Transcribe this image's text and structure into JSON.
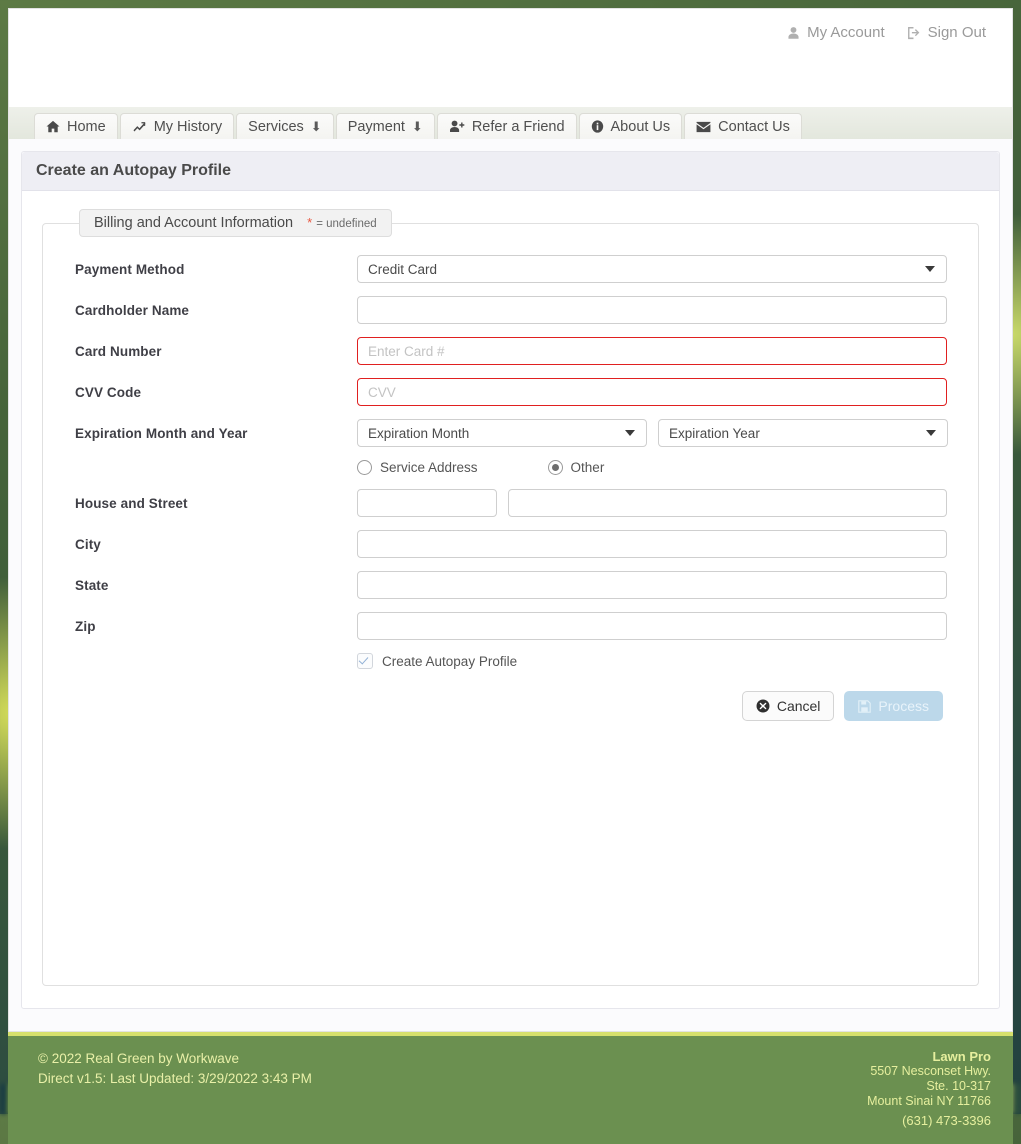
{
  "header": {
    "account_links": [
      {
        "label": "My Account",
        "icon": "user-icon"
      },
      {
        "label": "Sign Out",
        "icon": "sign-out-icon"
      }
    ]
  },
  "nav": {
    "tabs": [
      {
        "label": "Home",
        "icon": "home-icon",
        "caret": false
      },
      {
        "label": "My History",
        "icon": "chart-line-icon",
        "caret": false
      },
      {
        "label": "Services",
        "icon": "",
        "caret": true,
        "caret_glyph": "⬇"
      },
      {
        "label": "Payment",
        "icon": "",
        "caret": true,
        "caret_glyph": "⬇"
      },
      {
        "label": "Refer a Friend",
        "icon": "user-plus-icon",
        "caret": false
      },
      {
        "label": "About Us",
        "icon": "info-circle-icon",
        "caret": false
      },
      {
        "label": "Contact Us",
        "icon": "envelope-icon",
        "caret": false
      }
    ]
  },
  "panel": {
    "title": "Create an Autopay Profile",
    "legend": "Billing and Account Information",
    "legend_required_mark": "*",
    "legend_required_text": "= undefined"
  },
  "form": {
    "payment_method": {
      "label": "Payment Method",
      "value": "Credit Card",
      "options": [
        "Credit Card"
      ]
    },
    "cardholder_name": {
      "label": "Cardholder Name",
      "value": "",
      "placeholder": ""
    },
    "card_number": {
      "label": "Card Number",
      "value": "",
      "placeholder": "Enter Card #",
      "error": true
    },
    "cvv_code": {
      "label": "CVV Code",
      "value": "",
      "placeholder": "CVV",
      "error": true
    },
    "expiration": {
      "label": "Expiration Month and Year",
      "month_value": "Expiration Month",
      "year_value": "Expiration Year"
    },
    "address_source": {
      "options": [
        {
          "label": "Service Address",
          "selected": false
        },
        {
          "label": "Other",
          "selected": true
        }
      ]
    },
    "house_and_street": {
      "label": "House and Street",
      "house_value": "",
      "street_value": ""
    },
    "city": {
      "label": "City",
      "value": ""
    },
    "state": {
      "label": "State",
      "value": ""
    },
    "zip": {
      "label": "Zip",
      "value": ""
    },
    "create_autopay": {
      "label": "Create Autopay Profile",
      "checked": true
    }
  },
  "buttons": {
    "cancel": {
      "label": "Cancel",
      "icon": "circle-x-icon"
    },
    "process": {
      "label": "Process",
      "icon": "save-icon",
      "disabled": true
    }
  },
  "footer": {
    "copyright": "© 2022 Real Green by Workwave",
    "version": "Direct v1.5: Last Updated: 3/29/2022 3:43 PM",
    "business_name": "Lawn Pro",
    "address_line1": "5507 Nesconset Hwy.",
    "address_line2": "Ste. 10-317",
    "address_line3": "Mount Sinai NY 11766",
    "phone": "(631) 473-3396"
  },
  "colors": {
    "footer_bg": "#6b9050",
    "footer_accent": "#d6e06c",
    "error_border": "#e02020",
    "process_btn": "#bcd8ea"
  }
}
